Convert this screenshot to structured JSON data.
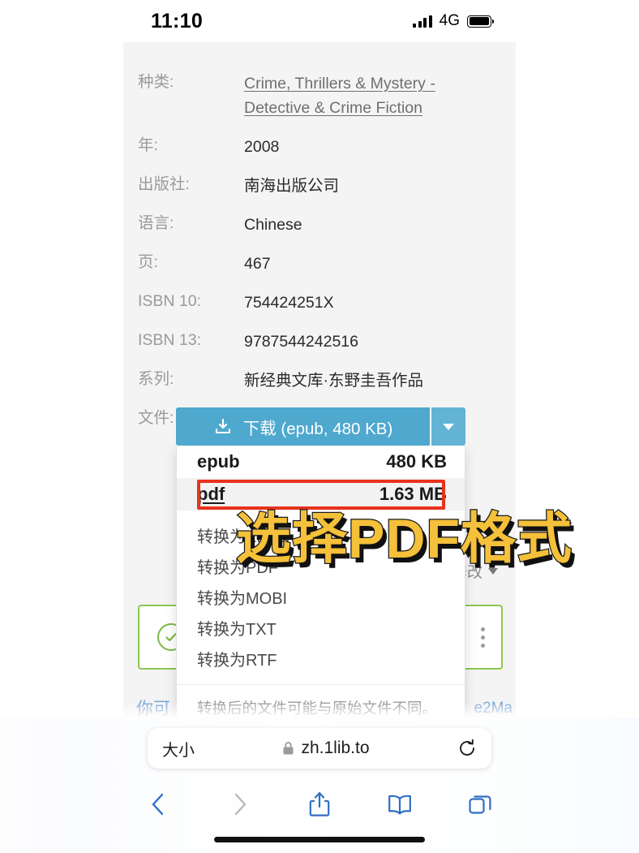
{
  "status_bar": {
    "time": "11:10",
    "network": "4G",
    "signal_icon": "signal-bars-icon",
    "battery_icon": "battery-full-icon"
  },
  "book_metadata": [
    {
      "key": "种类:",
      "value": "Crime, Thrillers & Mystery - Detective & Crime Fiction",
      "is_link": true
    },
    {
      "key": "年:",
      "value": "2008",
      "is_link": false
    },
    {
      "key": "出版社:",
      "value": "南海出版公司",
      "is_link": false
    },
    {
      "key": "语言:",
      "value": "Chinese",
      "is_link": false
    },
    {
      "key": "页:",
      "value": "467",
      "is_link": false
    },
    {
      "key": "ISBN 10:",
      "value": "754424251X",
      "is_link": false
    },
    {
      "key": "ISBN 13:",
      "value": "9787544242516",
      "is_link": false
    },
    {
      "key": "系列:",
      "value": "新经典文库·东野圭吾作品",
      "is_link": false
    },
    {
      "key": "文件:",
      "value": "EPUB, 480 KB",
      "is_link": false
    }
  ],
  "download": {
    "button_label": "下载 (epub, 480 KB)",
    "button_icon": "download-icon",
    "caret_icon": "chevron-down-icon",
    "button_color": "#4fa8ce",
    "caret_color": "#63b3d5",
    "files": [
      {
        "format": "epub",
        "size": "480 KB",
        "highlighted": false
      },
      {
        "format": "pdf",
        "size": "1.63 MB",
        "highlighted": true
      }
    ],
    "convert_items": [
      "转换为EPUB",
      "转换为PDF",
      "转换为MOBI",
      "转换为TXT",
      "转换为RTF"
    ],
    "footnote": "转换后的文件可能与原始文件不同。如"
  },
  "annotation": {
    "overlay_text": "选择PDF格式",
    "overlay_color": "#f5c03a",
    "box_color": "#e8331c"
  },
  "behind_panel": {
    "modify_label": "修改",
    "modify_caret_icon": "chevron-down-icon",
    "success_icon": "check-circle-icon",
    "kebab_icon": "more-vertical-icon",
    "left_text": "你可",
    "right_text": "e2Ma",
    "accent_green": "#8cc751"
  },
  "browser": {
    "text_size_label": "大小",
    "lock_icon": "lock-icon",
    "url": "zh.1lib.to",
    "reload_icon": "reload-icon",
    "toolbar": [
      {
        "name": "back-button",
        "icon": "chevron-left-icon",
        "enabled": true
      },
      {
        "name": "forward-button",
        "icon": "chevron-right-icon",
        "enabled": false
      },
      {
        "name": "share-button",
        "icon": "share-icon",
        "enabled": true
      },
      {
        "name": "bookmarks-button",
        "icon": "book-icon",
        "enabled": true
      },
      {
        "name": "tabs-button",
        "icon": "tabs-icon",
        "enabled": true
      }
    ]
  }
}
